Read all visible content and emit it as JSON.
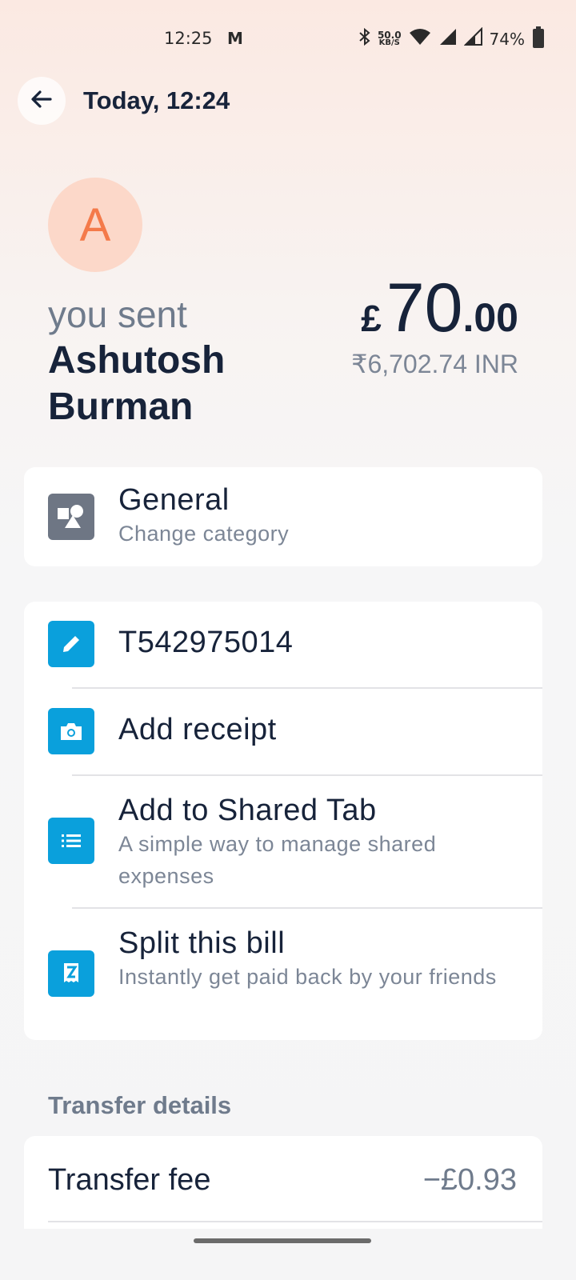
{
  "status_bar": {
    "time": "12:25",
    "app_badge": "M",
    "net_speed_value": "50.0",
    "net_speed_unit": "KB/S",
    "battery": "74%"
  },
  "header": {
    "title": "Today, 12:24",
    "back_icon": "arrow-left-icon"
  },
  "transaction": {
    "avatar_letter": "A",
    "direction_label": "you sent",
    "recipient_name": "Ashutosh Burman",
    "currency_symbol": "£",
    "amount_main": "70",
    "amount_decimal": ".00",
    "converted_amount": "₹6,702.74 INR"
  },
  "category": {
    "title": "General",
    "subtitle": "Change category",
    "icon": "shapes-icon"
  },
  "actions": [
    {
      "title": "T542975014",
      "subtitle": "",
      "icon": "pencil-icon"
    },
    {
      "title": "Add receipt",
      "subtitle": "",
      "icon": "camera-icon"
    },
    {
      "title": "Add to Shared Tab",
      "subtitle": "A simple way to manage shared expenses",
      "icon": "list-icon"
    },
    {
      "title": "Split this bill",
      "subtitle": "Instantly get paid back by your friends",
      "icon": "receipt-split-icon"
    }
  ],
  "transfer_details": {
    "section_title": "Transfer details",
    "fee_label": "Transfer fee",
    "fee_value": "−£0.93"
  },
  "colors": {
    "accent_blue": "#0aa0dc",
    "avatar_bg": "#fcd8c9",
    "avatar_fg": "#f47a4a",
    "category_icon_bg": "#6e7684"
  }
}
